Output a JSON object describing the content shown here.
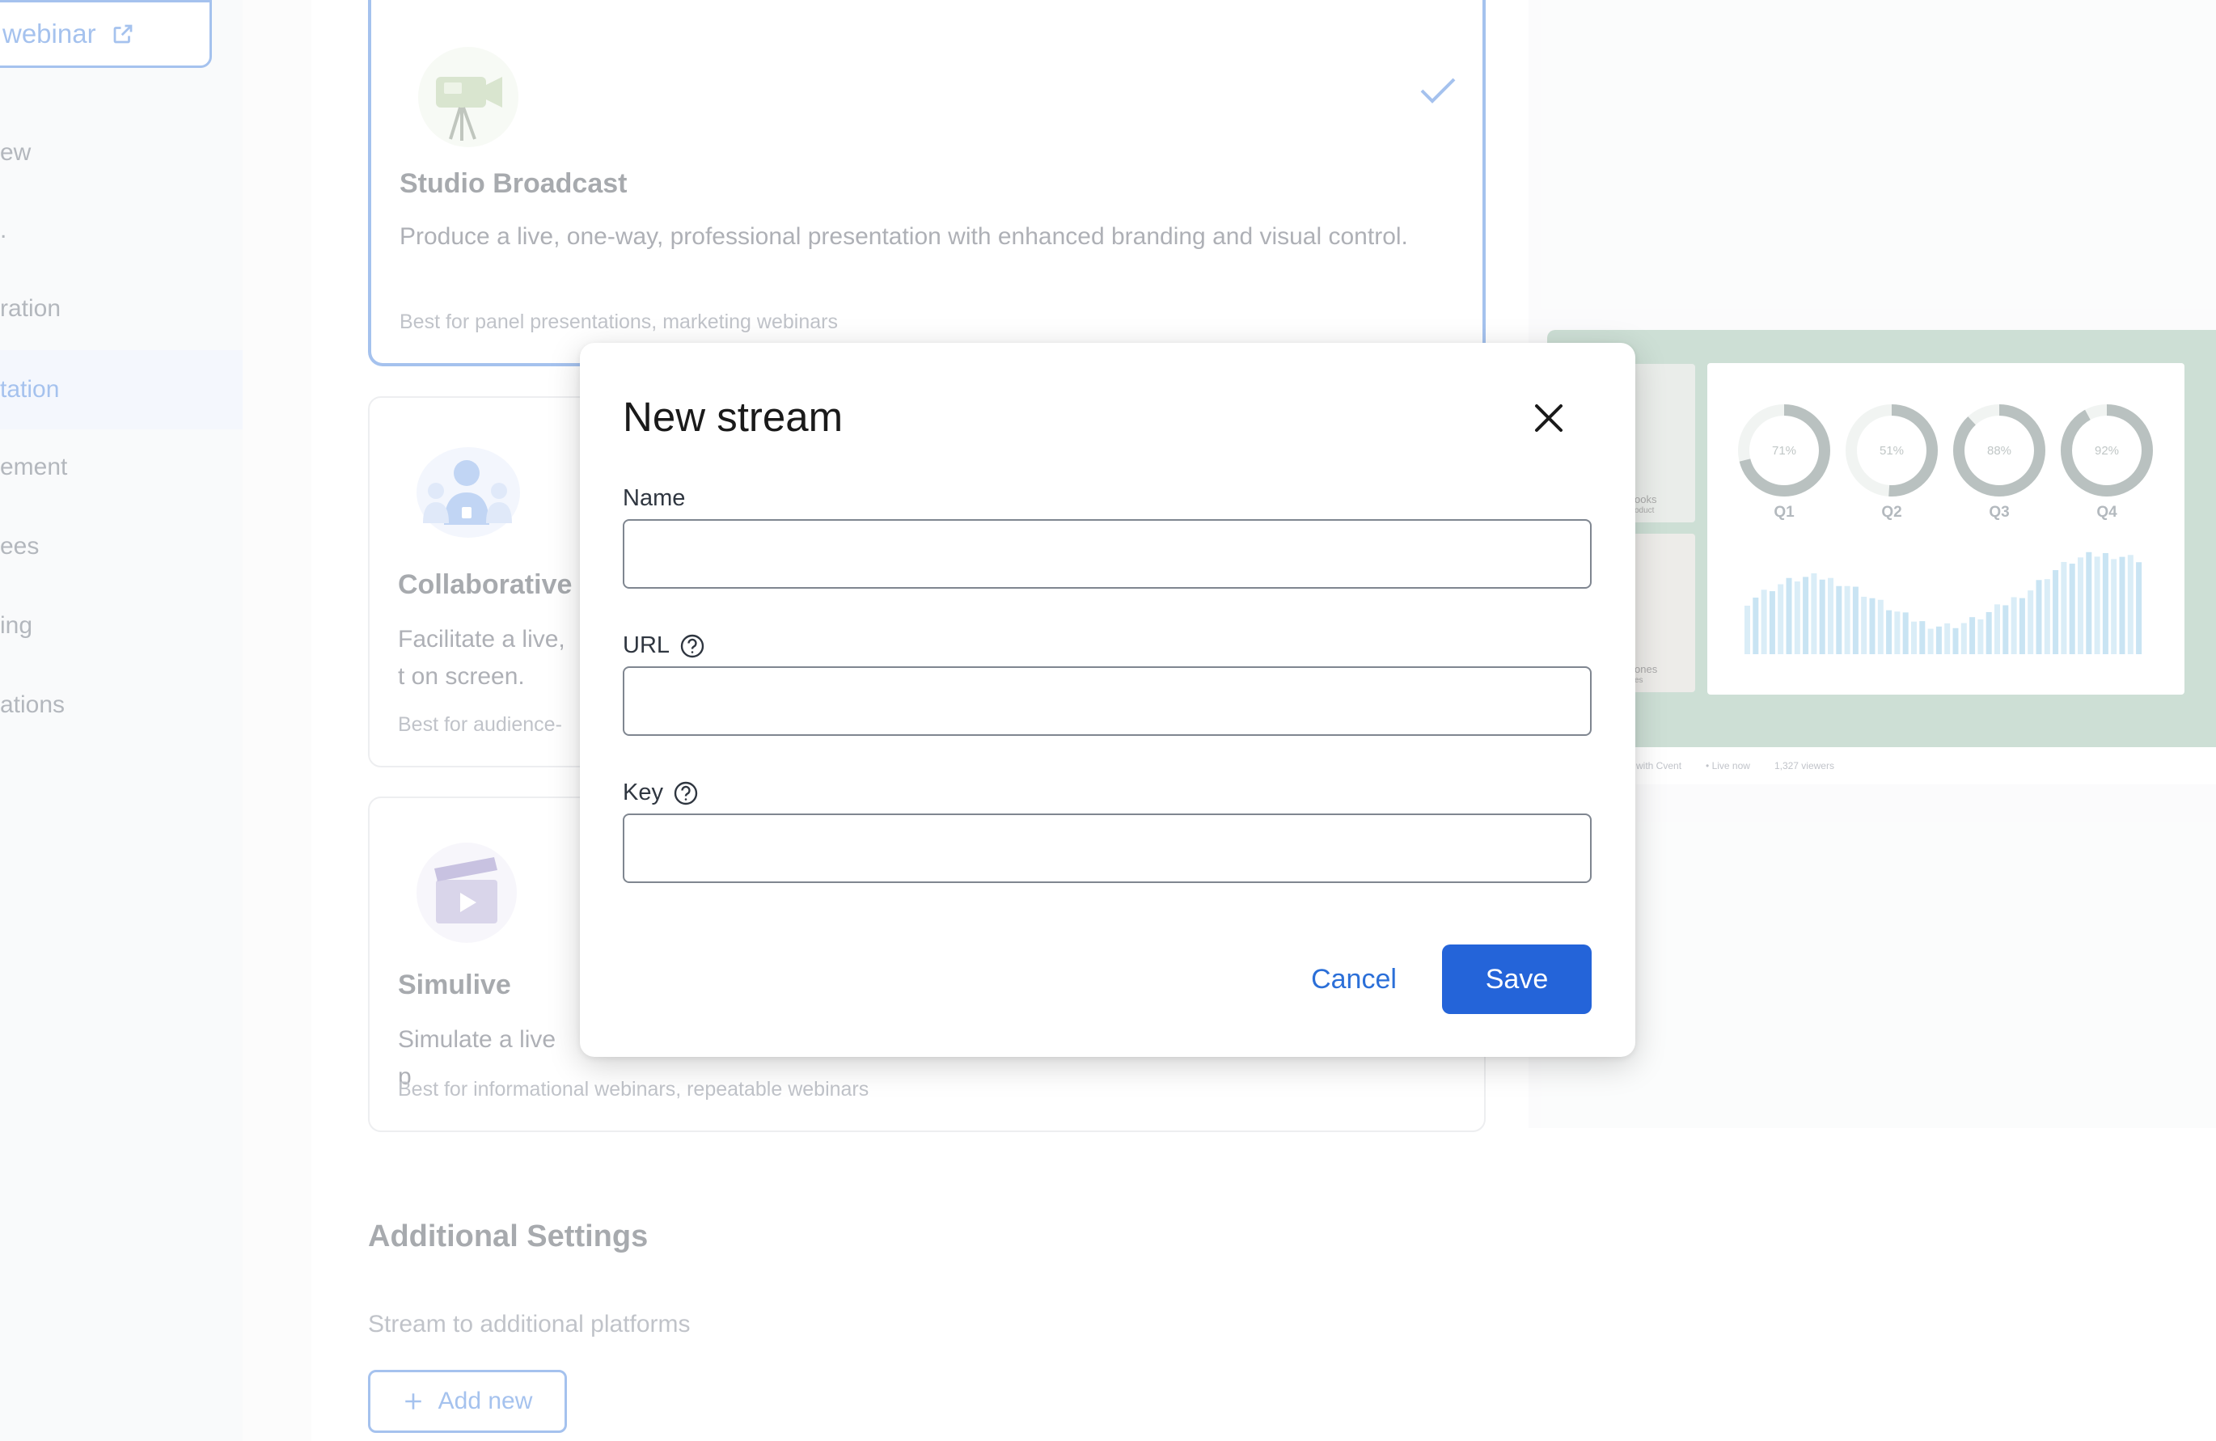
{
  "sidebar": {
    "view_webinar_label": "webinar",
    "items": [
      {
        "label": "ew"
      },
      {
        "label": "."
      },
      {
        "label": "ration"
      },
      {
        "label": "tation"
      },
      {
        "label": "ement"
      },
      {
        "label": "ees"
      },
      {
        "label": "ing"
      },
      {
        "label": "ations"
      }
    ]
  },
  "experience_cards": [
    {
      "title": "Studio Broadcast",
      "description": "Produce a live, one-way, professional presentation with enhanced branding and visual control.",
      "best_for": "Best for panel presentations, marketing webinars",
      "selected": true
    },
    {
      "title": "Collaborative",
      "description": "Facilitate a live, t on screen.",
      "best_for": "Best for audience-",
      "selected": false
    },
    {
      "title": "Simulive",
      "description": "Simulate a live p",
      "best_for": "Best for informational webinars, repeatable webinars",
      "selected": false
    }
  ],
  "additional_settings": {
    "title": "Additional Settings",
    "description": "Stream to additional platforms",
    "add_new_label": "Add new"
  },
  "preview": {
    "tiles": [
      {
        "name": "ooks",
        "role": "oduct"
      },
      {
        "name": "ones",
        "role": "es"
      }
    ],
    "quarters": [
      {
        "label": "Q1",
        "percent_label": "71%",
        "value": 71
      },
      {
        "label": "Q2",
        "percent_label": "51%",
        "value": 51
      },
      {
        "label": "Q3",
        "percent_label": "88%",
        "value": 88
      },
      {
        "label": "Q4",
        "percent_label": "92%",
        "value": 92
      }
    ],
    "footer": {
      "brand": "with Cvent",
      "status": "• Live now",
      "viewers": "1,327 viewers"
    }
  },
  "modal": {
    "title": "New stream",
    "fields": {
      "name": {
        "label": "Name",
        "value": "",
        "placeholder": ""
      },
      "url": {
        "label": "URL",
        "value": "",
        "placeholder": ""
      },
      "key": {
        "label": "Key",
        "value": "",
        "placeholder": ""
      }
    },
    "cancel_label": "Cancel",
    "save_label": "Save"
  },
  "colors": {
    "accent": "#2464d9",
    "link": "#2b6fd8",
    "input_border": "#7f8690"
  }
}
